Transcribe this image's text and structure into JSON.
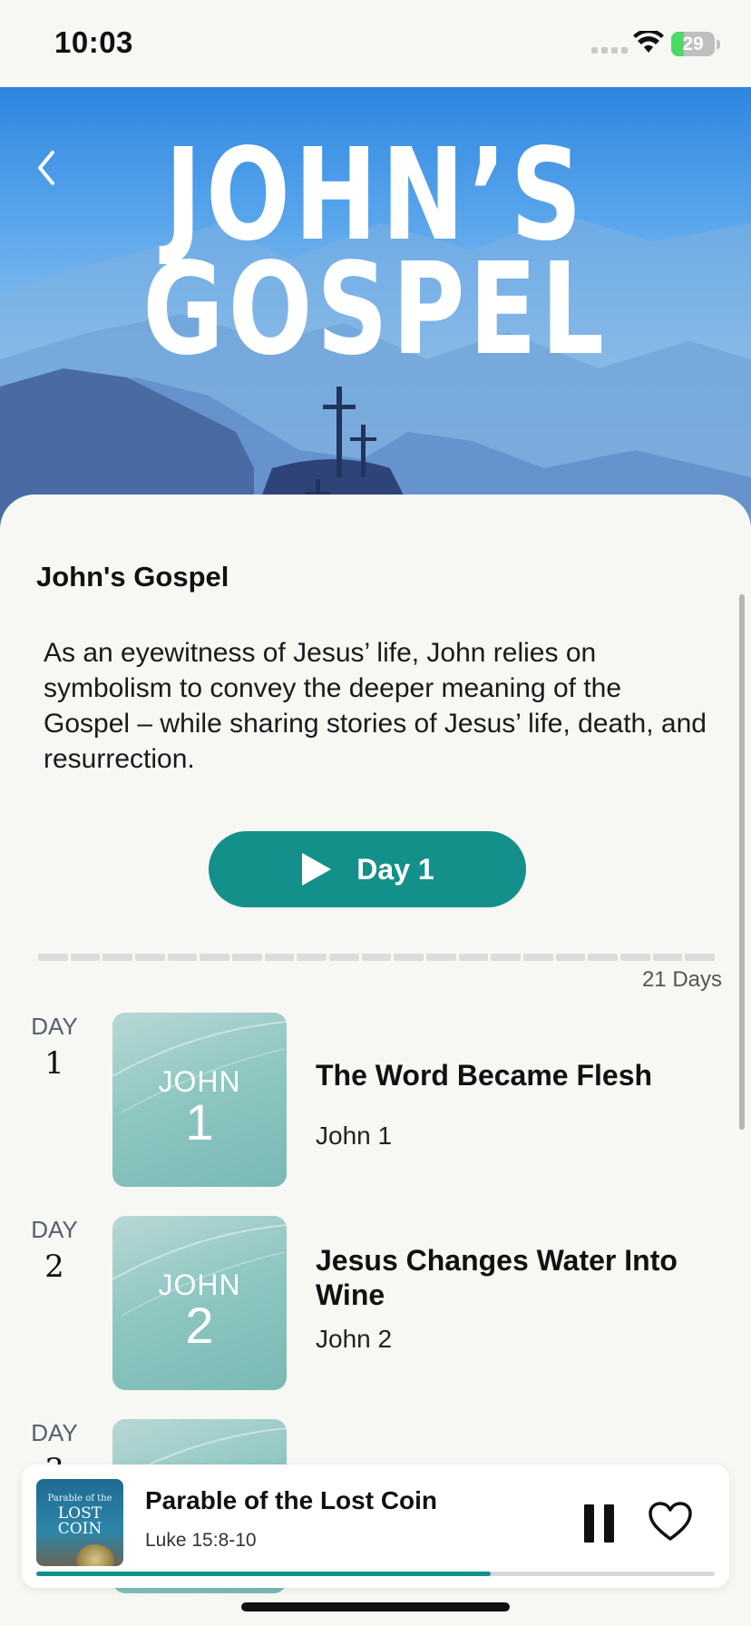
{
  "status_bar": {
    "time": "10:03",
    "battery": "29",
    "battery_level": 0.29
  },
  "hero": {
    "line1": "JOHN’S",
    "line2": "GOSPEL"
  },
  "plan": {
    "title": "John's Gospel",
    "description": "As an eyewitness of Jesus’ life, John relies on symbolism to convey the deeper meaning of the Gospel – while sharing stories of Jesus’ life, death, and resurrection.",
    "start_button": "Day 1",
    "total_days": "21 Days",
    "segments": 21
  },
  "days": [
    {
      "label": "DAY",
      "num": "1",
      "thumb_top": "JOHN",
      "thumb_num": "1",
      "title": "The Word Became Flesh",
      "ref": "John 1"
    },
    {
      "label": "DAY",
      "num": "2",
      "thumb_top": "JOHN",
      "thumb_num": "2",
      "title": "Jesus Changes Water Into Wine",
      "ref": "John 2"
    },
    {
      "label": "DAY",
      "num": "3"
    }
  ],
  "player": {
    "art_line1": "Parable of the",
    "art_line2": "LOST COIN",
    "title": "Parable of the Lost Coin",
    "ref": "Luke 15:8-10",
    "progress": 0.67
  },
  "colors": {
    "accent": "#13908a",
    "hero_sky": "#2f86e0"
  }
}
